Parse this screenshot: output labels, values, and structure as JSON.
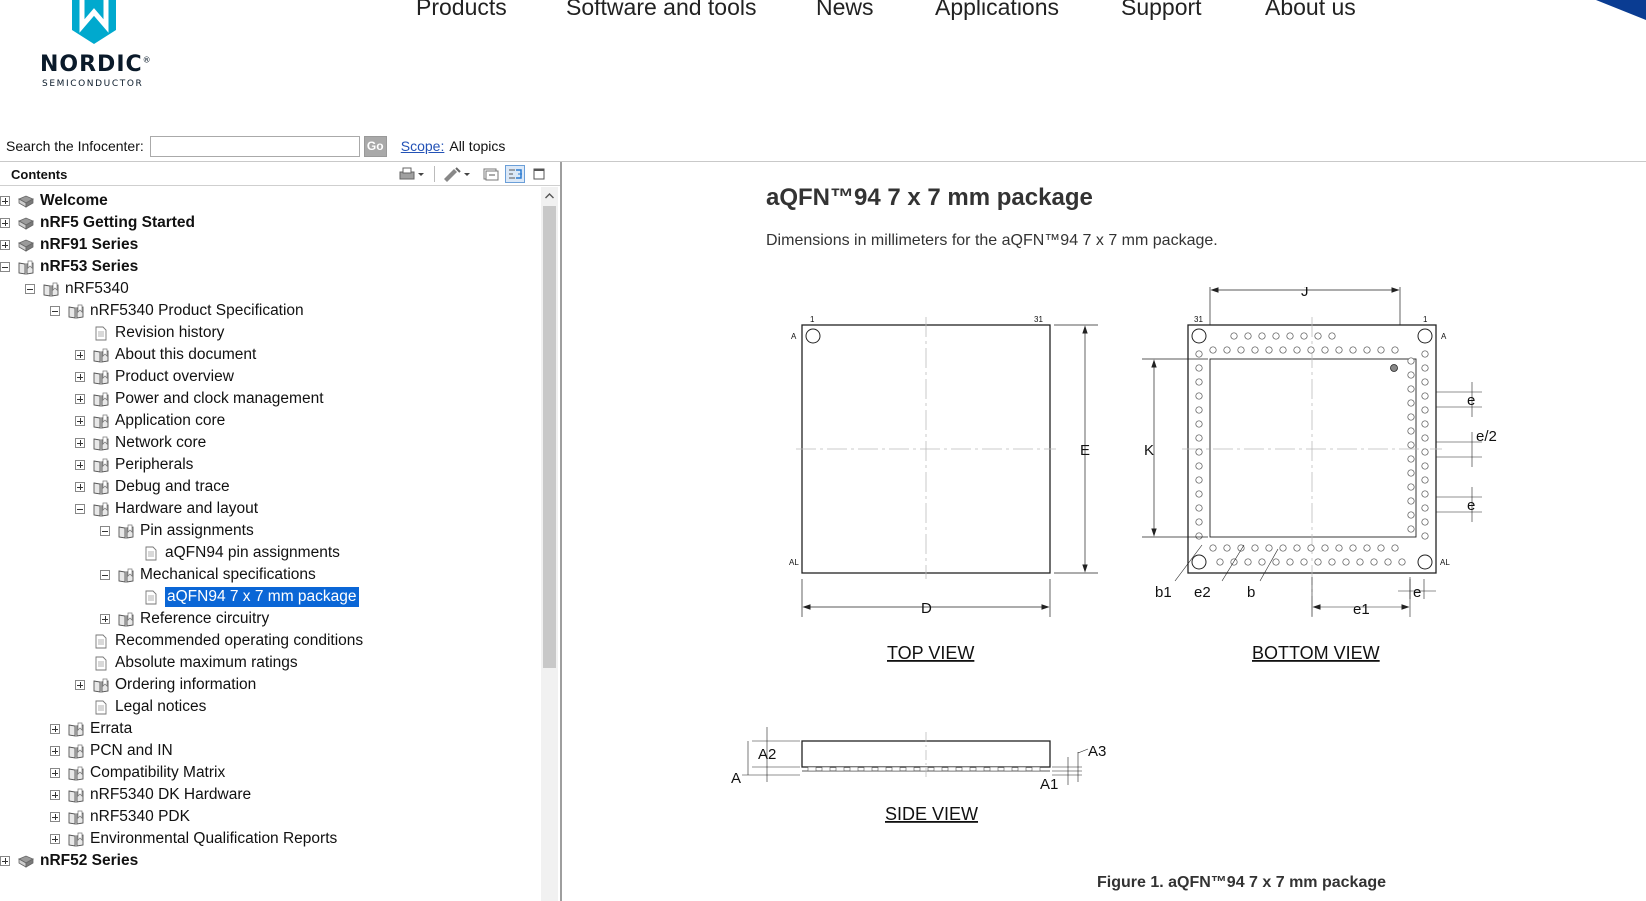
{
  "header": {
    "logo_word": "NORDIC",
    "logo_sub": "SEMICONDUCTOR",
    "nav": [
      "Products",
      "Software and tools",
      "News",
      "Applications",
      "Support",
      "About us"
    ],
    "brand_color": "#00a9ce"
  },
  "search": {
    "label": "Search the Infocenter:",
    "value": "",
    "go_label": "Go",
    "scope_label": "Scope:",
    "scope_value": "All topics"
  },
  "sidebar": {
    "title": "Contents",
    "tree": [
      {
        "label": "Welcome",
        "level": 0,
        "twisty": "plus",
        "icon": "book-closed",
        "bold": true
      },
      {
        "label": "nRF5 Getting Started",
        "level": 0,
        "twisty": "plus",
        "icon": "book-closed",
        "bold": true
      },
      {
        "label": "nRF91 Series",
        "level": 0,
        "twisty": "plus",
        "icon": "book-closed",
        "bold": true
      },
      {
        "label": "nRF53 Series",
        "level": 0,
        "twisty": "minus",
        "icon": "book-open",
        "bold": true
      },
      {
        "label": "nRF5340",
        "level": 1,
        "twisty": "minus",
        "icon": "book-open"
      },
      {
        "label": "nRF5340 Product Specification",
        "level": 2,
        "twisty": "minus",
        "icon": "book-open"
      },
      {
        "label": "Revision history",
        "level": 3,
        "twisty": "none",
        "icon": "page"
      },
      {
        "label": "About this document",
        "level": 3,
        "twisty": "plus",
        "icon": "book-open"
      },
      {
        "label": "Product overview",
        "level": 3,
        "twisty": "plus",
        "icon": "book-open"
      },
      {
        "label": "Power and clock management",
        "level": 3,
        "twisty": "plus",
        "icon": "book-open"
      },
      {
        "label": "Application core",
        "level": 3,
        "twisty": "plus",
        "icon": "book-open"
      },
      {
        "label": "Network core",
        "level": 3,
        "twisty": "plus",
        "icon": "book-open"
      },
      {
        "label": "Peripherals",
        "level": 3,
        "twisty": "plus",
        "icon": "book-open"
      },
      {
        "label": "Debug and trace",
        "level": 3,
        "twisty": "plus",
        "icon": "book-open"
      },
      {
        "label": "Hardware and layout",
        "level": 3,
        "twisty": "minus",
        "icon": "book-open"
      },
      {
        "label": "Pin assignments",
        "level": 4,
        "twisty": "minus",
        "icon": "book-open"
      },
      {
        "label": "aQFN94 pin assignments",
        "level": 5,
        "twisty": "none",
        "icon": "page"
      },
      {
        "label": "Mechanical specifications",
        "level": 4,
        "twisty": "minus",
        "icon": "book-open"
      },
      {
        "label": "aQFN94 7 x 7 mm package",
        "level": 5,
        "twisty": "none",
        "icon": "page",
        "selected": true
      },
      {
        "label": "Reference circuitry",
        "level": 4,
        "twisty": "plus",
        "icon": "book-open"
      },
      {
        "label": "Recommended operating conditions",
        "level": 3,
        "twisty": "none",
        "icon": "page"
      },
      {
        "label": "Absolute maximum ratings",
        "level": 3,
        "twisty": "none",
        "icon": "page"
      },
      {
        "label": "Ordering information",
        "level": 3,
        "twisty": "plus",
        "icon": "book-open"
      },
      {
        "label": "Legal notices",
        "level": 3,
        "twisty": "none",
        "icon": "page"
      },
      {
        "label": "Errata",
        "level": 2,
        "twisty": "plus",
        "icon": "book-open"
      },
      {
        "label": "PCN and IN",
        "level": 2,
        "twisty": "plus",
        "icon": "book-open"
      },
      {
        "label": "Compatibility Matrix",
        "level": 2,
        "twisty": "plus",
        "icon": "book-open"
      },
      {
        "label": "nRF5340 DK Hardware",
        "level": 2,
        "twisty": "plus",
        "icon": "book-open"
      },
      {
        "label": "nRF5340 PDK",
        "level": 2,
        "twisty": "plus",
        "icon": "book-open"
      },
      {
        "label": "Environmental Qualification Reports",
        "level": 2,
        "twisty": "plus",
        "icon": "book-open"
      },
      {
        "label": "nRF52 Series",
        "level": 0,
        "twisty": "plus",
        "icon": "book-closed",
        "bold": true
      }
    ],
    "selected_color": "#0a66d6"
  },
  "content": {
    "title": "aQFN™94 7 x 7 mm package",
    "description": "Dimensions in millimeters for the aQFN™94 7 x 7 mm package.",
    "figure": {
      "top_view_label": "TOP VIEW",
      "bottom_view_label": "BOTTOM VIEW",
      "side_view_label": "SIDE VIEW",
      "caption": "Figure 1. aQFN™94 7 x 7 mm package",
      "dimension_labels": {
        "D": "D",
        "E": "E",
        "J": "J",
        "K": "K",
        "e": "e",
        "e_half": "e/2",
        "e1": "e1",
        "e2": "e2",
        "b": "b",
        "b1": "b1",
        "A": "A",
        "A1": "A1",
        "A2": "A2",
        "A3": "A3"
      },
      "corner_labels": {
        "pin1": "1",
        "pin31": "31",
        "row_a": "A",
        "row_al": "AL"
      }
    }
  }
}
